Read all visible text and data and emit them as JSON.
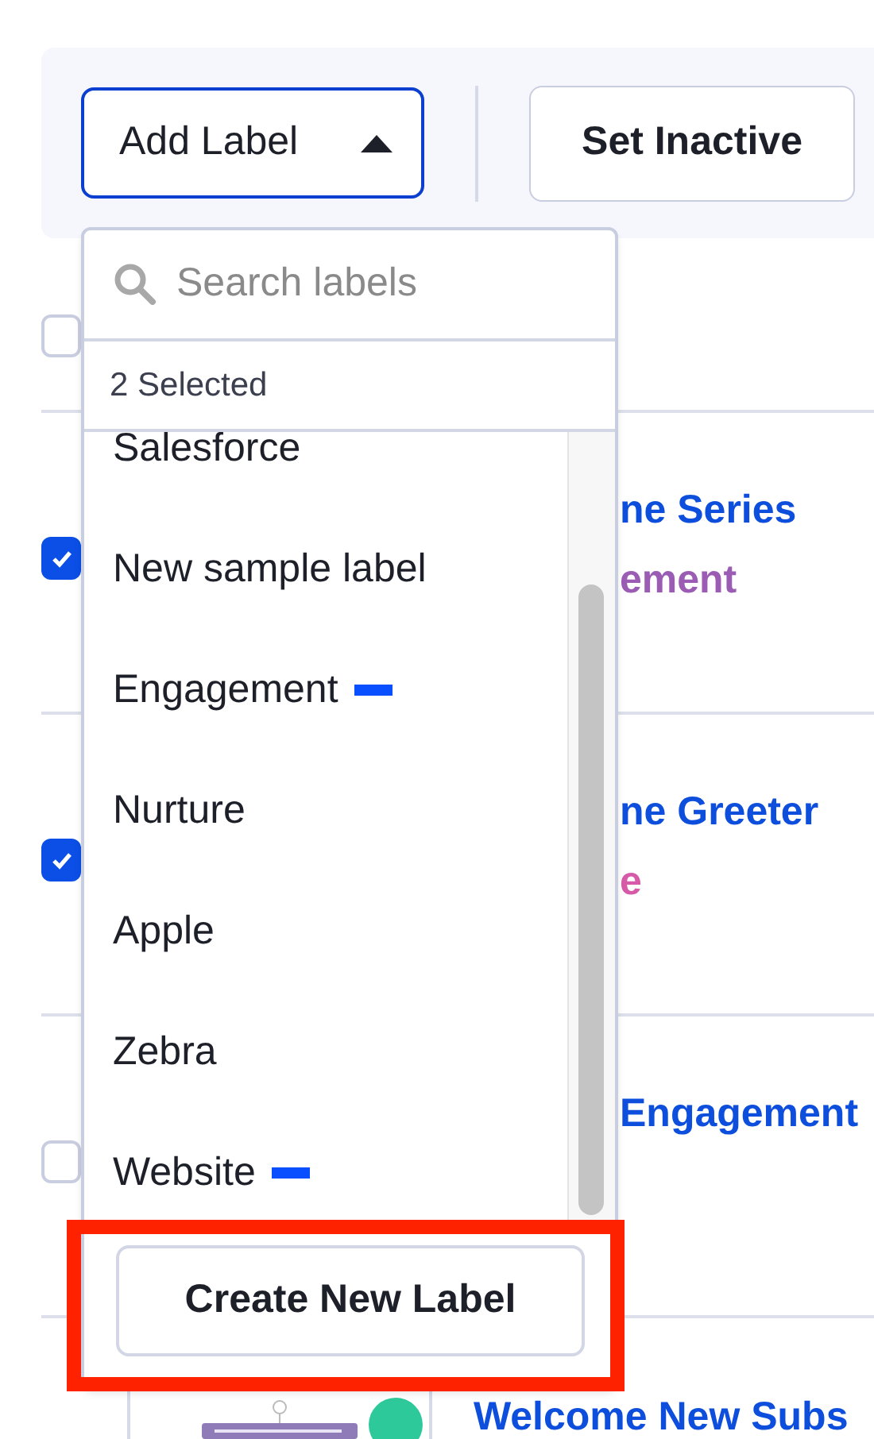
{
  "toolbar": {
    "add_label_button": {
      "label": "Add Label",
      "expanded": true
    },
    "set_inactive_button": {
      "label": "Set Inactive"
    }
  },
  "table": {
    "header_checkbox": {
      "checked": false
    },
    "rows": [
      {
        "checked": true,
        "title": "ne Series",
        "label": {
          "text": "ement",
          "color": "#9b5cb4"
        }
      },
      {
        "checked": true,
        "title": "ne Greeter",
        "label": {
          "text": "e",
          "color": "#d65aa8"
        }
      },
      {
        "checked": false,
        "title": "Engagement"
      },
      {
        "title": "Welcome New Subs",
        "status_dot": {
          "color": "#2ec99a"
        }
      }
    ]
  },
  "label_menu": {
    "search": {
      "placeholder": "Search labels"
    },
    "selected_count": "2 Selected",
    "items": [
      {
        "name": "Salesforce"
      },
      {
        "name": "New sample label"
      },
      {
        "name": "Engagement",
        "color": "#0a4fff"
      },
      {
        "name": "Nurture"
      },
      {
        "name": "Apple"
      },
      {
        "name": "Zebra"
      },
      {
        "name": "Website",
        "color": "#0a4fff"
      }
    ],
    "create_button": "Create New Label"
  }
}
